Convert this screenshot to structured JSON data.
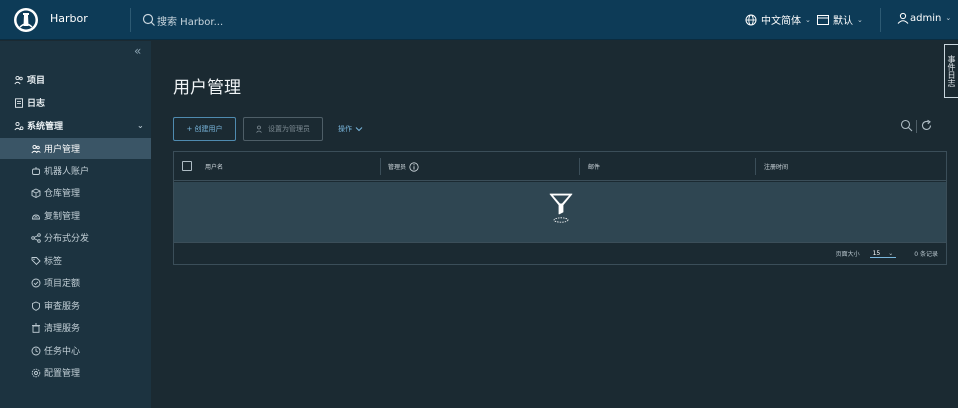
{
  "header": {
    "brand": "Harbor",
    "search_placeholder": "搜索 Harbor...",
    "language": "中文简体",
    "scope": "默认",
    "user": "admin"
  },
  "sidebar": {
    "items": [
      {
        "label": "项目",
        "icon": "projects-icon"
      },
      {
        "label": "日志",
        "icon": "logs-icon"
      },
      {
        "label": "系统管理",
        "icon": "system-admin-icon"
      },
      {
        "label": "用户管理",
        "icon": "users-icon",
        "active": true
      },
      {
        "label": "机器人账户",
        "icon": "robot-icon"
      },
      {
        "label": "仓库管理",
        "icon": "registries-icon"
      },
      {
        "label": "复制管理",
        "icon": "replication-icon"
      },
      {
        "label": "分布式分发",
        "icon": "distribution-icon"
      },
      {
        "label": "标签",
        "icon": "labels-icon"
      },
      {
        "label": "项目定额",
        "icon": "quotas-icon"
      },
      {
        "label": "审查服务",
        "icon": "interrogation-icon"
      },
      {
        "label": "清理服务",
        "icon": "clean-up-icon"
      },
      {
        "label": "任务中心",
        "icon": "job-service-icon"
      },
      {
        "label": "配置管理",
        "icon": "configuration-icon"
      }
    ]
  },
  "main": {
    "title": "用户管理",
    "new_user_label": "+ 创建用户",
    "set_admin_label": "设置为管理员",
    "actions_label": "操作",
    "columns": [
      "用户名",
      "管理员",
      "邮件",
      "注册时间"
    ],
    "page_size_label": "页面大小",
    "page_size": "15",
    "record_count": "0 条记录"
  },
  "side_tab": "事件日志",
  "colors": {
    "header_bg": "#0d3b57",
    "sidebar_bg": "#1c3340",
    "content_bg": "#1b2a32",
    "accent": "#79b6dc",
    "active_item": "#3a5566"
  }
}
